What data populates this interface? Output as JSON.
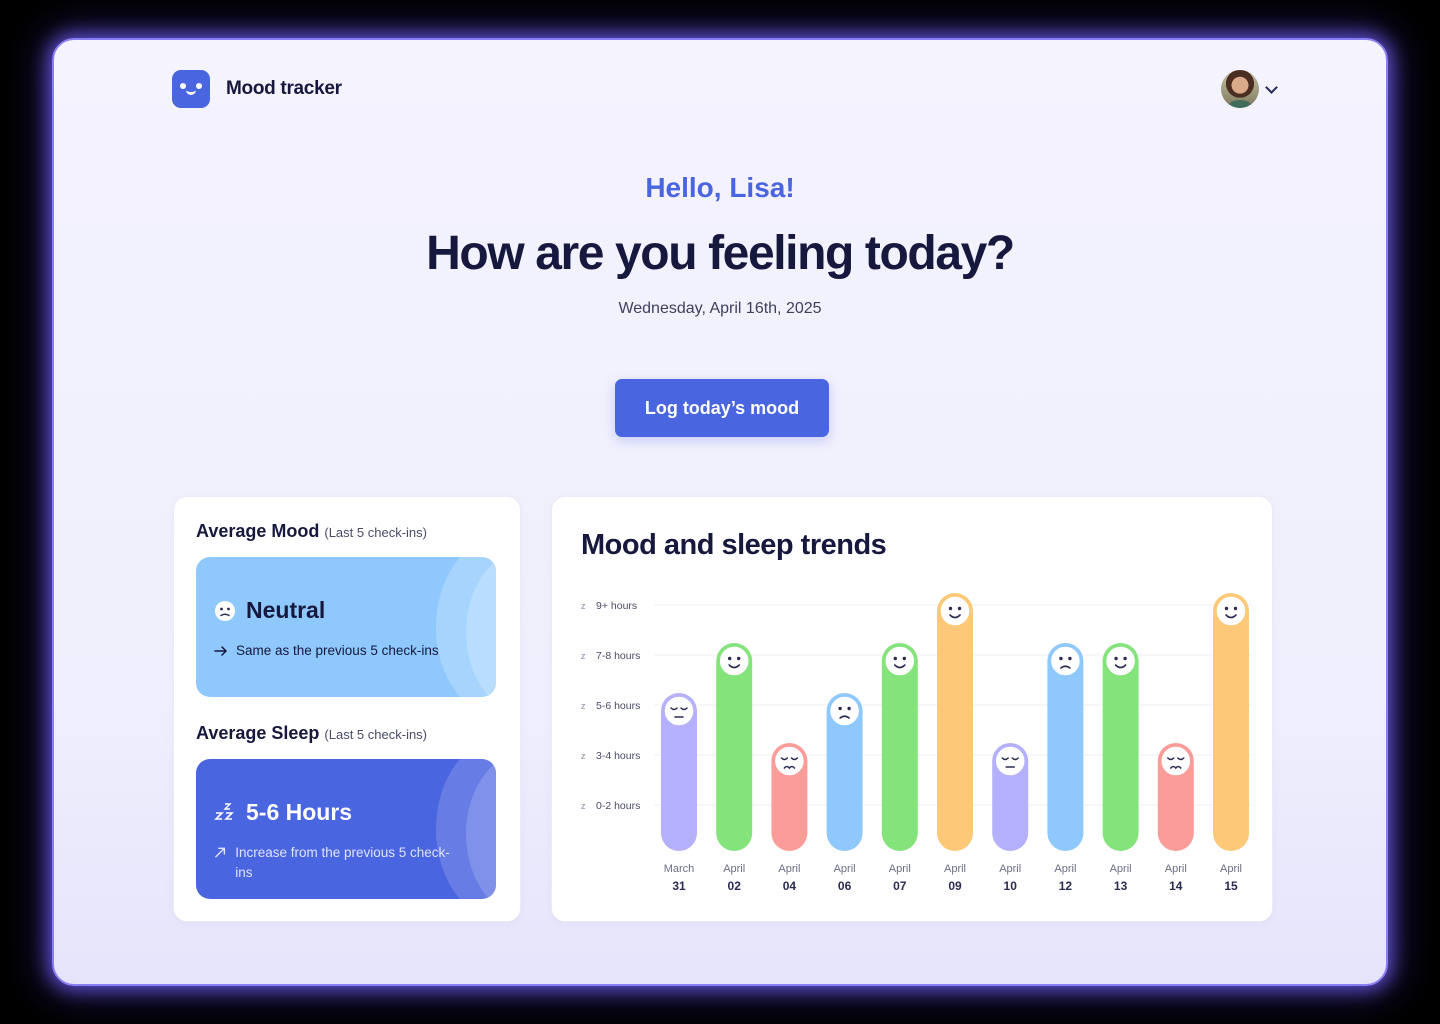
{
  "app": {
    "brand": "Mood tracker"
  },
  "hero": {
    "greeting": "Hello, Lisa!",
    "headline": "How are you feeling today?",
    "date": "Wednesday, April 16th, 2025",
    "cta_label": "Log today’s mood"
  },
  "summary": {
    "mood": {
      "title": "Average Mood",
      "qualifier": "(Last 5 check-ins)",
      "value": "Neutral",
      "note": "Same as the previous 5 check-ins",
      "icon": "neutral-face-icon"
    },
    "sleep": {
      "title": "Average Sleep",
      "qualifier": "(Last 5 check-ins)",
      "value": "5-6 Hours",
      "note": "Increase from the previous 5 check-ins",
      "icon": "zzz-icon"
    }
  },
  "colors": {
    "accent": "#4a65e0",
    "mood_colors": {
      "happy": "#85e37c",
      "very_happy": "#fdc978",
      "neutral": "#8ec8fc",
      "tired": "#b5b0fb",
      "sad": "#fc9c98"
    }
  },
  "chart_data": {
    "type": "bar",
    "title": "Mood and sleep trends",
    "y_ticks": [
      "9+ hours",
      "7-8 hours",
      "5-6 hours",
      "3-4 hours",
      "0-2 hours"
    ],
    "categories": [
      {
        "month": "March",
        "day": "31"
      },
      {
        "month": "April",
        "day": "02"
      },
      {
        "month": "April",
        "day": "04"
      },
      {
        "month": "April",
        "day": "06"
      },
      {
        "month": "April",
        "day": "07"
      },
      {
        "month": "April",
        "day": "09"
      },
      {
        "month": "April",
        "day": "10"
      },
      {
        "month": "April",
        "day": "12"
      },
      {
        "month": "April",
        "day": "13"
      },
      {
        "month": "April",
        "day": "14"
      },
      {
        "month": "April",
        "day": "15"
      }
    ],
    "sleep_level": [
      3,
      4,
      2,
      3,
      4,
      5,
      2,
      4,
      4,
      2,
      5
    ],
    "mood": [
      "tired",
      "happy",
      "sad",
      "neutral",
      "happy",
      "very_happy",
      "tired",
      "neutral",
      "happy",
      "sad",
      "very_happy"
    ],
    "grid": true
  }
}
